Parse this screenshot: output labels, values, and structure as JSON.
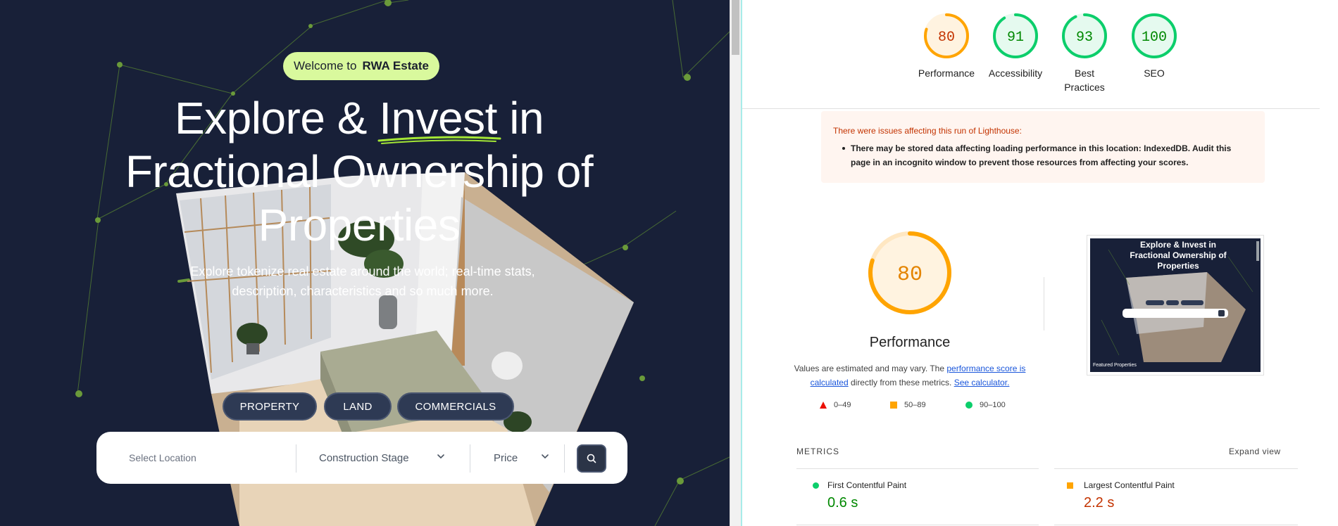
{
  "hero": {
    "welcome_prefix": "Welcome to",
    "welcome_brand": "RWA Estate",
    "title_line1_a": "Explore & ",
    "title_line1_accent": "Invest",
    "title_line1_b": " in",
    "title_line2": "Fractional Ownership of",
    "title_line3": "Properties",
    "subtitle": "Explore tokenize real estate around the world; real-time stats, description, characteristics and so much more.",
    "categories": [
      "PROPERTY",
      "LAND",
      "COMMERCIALS"
    ],
    "search": {
      "location_placeholder": "Select Location",
      "stage_label": "Construction Stage",
      "price_label": "Price"
    },
    "colors": {
      "background": "#182038",
      "accent": "#d9f99d",
      "network": "#5b8a32"
    }
  },
  "lighthouse": {
    "scores": [
      {
        "value": "80",
        "label": "Performance",
        "fraction": 0.8,
        "status": "average"
      },
      {
        "value": "91",
        "label": "Accessibility",
        "fraction": 0.91,
        "status": "pass"
      },
      {
        "value": "93",
        "label": "Best Practices",
        "fraction": 0.93,
        "status": "pass"
      },
      {
        "value": "100",
        "label": "SEO",
        "fraction": 1.0,
        "status": "pass"
      }
    ],
    "warning": {
      "title": "There were issues affecting this run of Lighthouse:",
      "item": "There may be stored data affecting loading performance in this location: IndexedDB. Audit this page in an incognito window to prevent those resources from affecting your scores."
    },
    "performance": {
      "score": "80",
      "fraction": 0.8,
      "title": "Performance",
      "note_prefix": "Values are estimated and may vary. The ",
      "note_link1": "performance score is calculated",
      "note_middle": " directly from these metrics. ",
      "note_link2": "See calculator."
    },
    "legend": [
      {
        "shape": "triangle",
        "range": "0–49",
        "color": "#eb0f00"
      },
      {
        "shape": "square",
        "range": "50–89",
        "color": "#ffa400"
      },
      {
        "shape": "circle",
        "range": "90–100",
        "color": "#0cce6b"
      }
    ],
    "thumbnail": {
      "title": "Explore & Invest in Fractional Ownership of Properties",
      "footer": "Featured Properties"
    },
    "metrics_heading": "METRICS",
    "expand_label": "Expand view",
    "metrics": [
      {
        "name": "First Contentful Paint",
        "value": "0.6 s",
        "status": "pass"
      },
      {
        "name": "Largest Contentful Paint",
        "value": "2.2 s",
        "status": "average"
      }
    ],
    "colors": {
      "pass": "#0cce6b",
      "pass_text": "#008800",
      "average": "#ffa400",
      "average_text": "#c33300",
      "fail": "#eb0f00"
    }
  }
}
